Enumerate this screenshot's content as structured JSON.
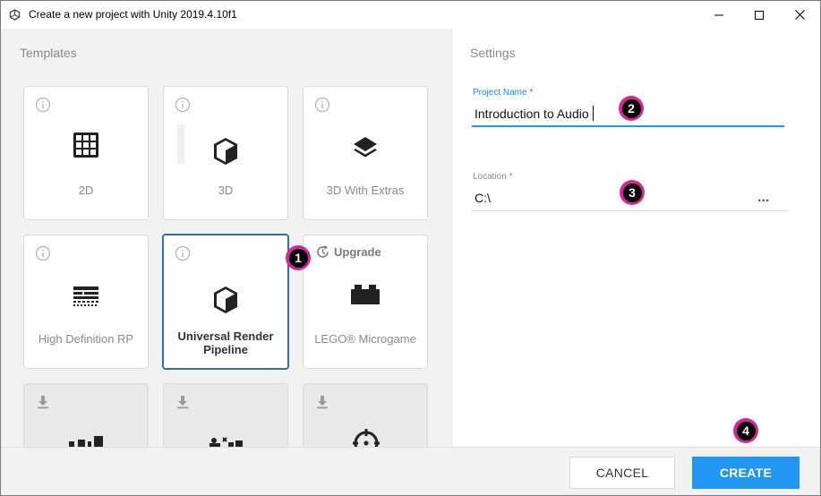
{
  "window": {
    "title": "Create a new project with Unity 2019.4.10f1"
  },
  "templates": {
    "heading": "Templates",
    "cards": [
      {
        "label": "2D",
        "icon": "grid-icon",
        "state": "normal"
      },
      {
        "label": "3D",
        "icon": "cube-icon",
        "state": "normal"
      },
      {
        "label": "3D With Extras",
        "icon": "layers-icon",
        "state": "normal"
      },
      {
        "label": "High Definition RP",
        "icon": "hdrp-icon",
        "state": "normal"
      },
      {
        "label": "Universal Render Pipeline",
        "icon": "cube-icon",
        "state": "selected"
      },
      {
        "label": "LEGO® Microgame",
        "icon": "lego-brick-icon",
        "state": "upgrade"
      },
      {
        "label": "",
        "icon": "download-icon",
        "state": "download"
      },
      {
        "label": "",
        "icon": "download-icon",
        "state": "download"
      },
      {
        "label": "",
        "icon": "download-icon",
        "state": "download"
      }
    ],
    "upgrade_label": "Upgrade"
  },
  "settings": {
    "heading": "Settings",
    "project_name": {
      "label": "Project Name",
      "required_mark": "*",
      "value": "Introduction to Audio"
    },
    "location": {
      "label": "Location",
      "required_mark": "*",
      "value": "C:\\",
      "browse_label": "..."
    }
  },
  "footer": {
    "cancel_label": "CANCEL",
    "create_label": "CREATE"
  },
  "callouts": [
    "1",
    "2",
    "3",
    "4"
  ],
  "colors": {
    "accent": "#2196f3",
    "selected_border": "#2f6ea8",
    "callout_ring": "#d4279a"
  }
}
